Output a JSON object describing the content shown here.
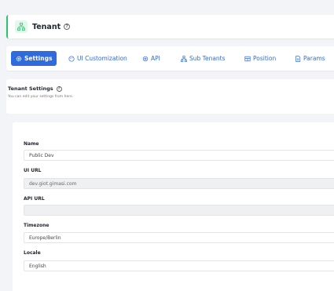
{
  "header": {
    "title": "Tenant",
    "icon": "sitemap-icon"
  },
  "tabs": [
    {
      "label": "Settings",
      "icon": "gear-icon",
      "active": true
    },
    {
      "label": "UI Customization",
      "icon": "palette-icon",
      "active": false
    },
    {
      "label": "API",
      "icon": "cog-icon",
      "active": false
    },
    {
      "label": "Sub Tenants",
      "icon": "sitemap-icon",
      "active": false
    },
    {
      "label": "Position",
      "icon": "position-icon",
      "active": false
    },
    {
      "label": "Params",
      "icon": "document-icon",
      "active": false
    }
  ],
  "settings": {
    "title": "Tenant Settings",
    "subtitle": "You can edit your settings from here."
  },
  "form": {
    "name_label": "Name",
    "name_value": "Public Dev",
    "uiurl_label": "UI URL",
    "uiurl_value": "dev.giot.gimasi.com",
    "apiurl_label": "API URL",
    "apiurl_value": "",
    "timezone_label": "Timezone",
    "timezone_value": "Europe/Berlin",
    "locale_label": "Locale",
    "locale_value": "English"
  },
  "colors": {
    "accent": "#2f6bdd",
    "header_bar": "#29c46b"
  }
}
